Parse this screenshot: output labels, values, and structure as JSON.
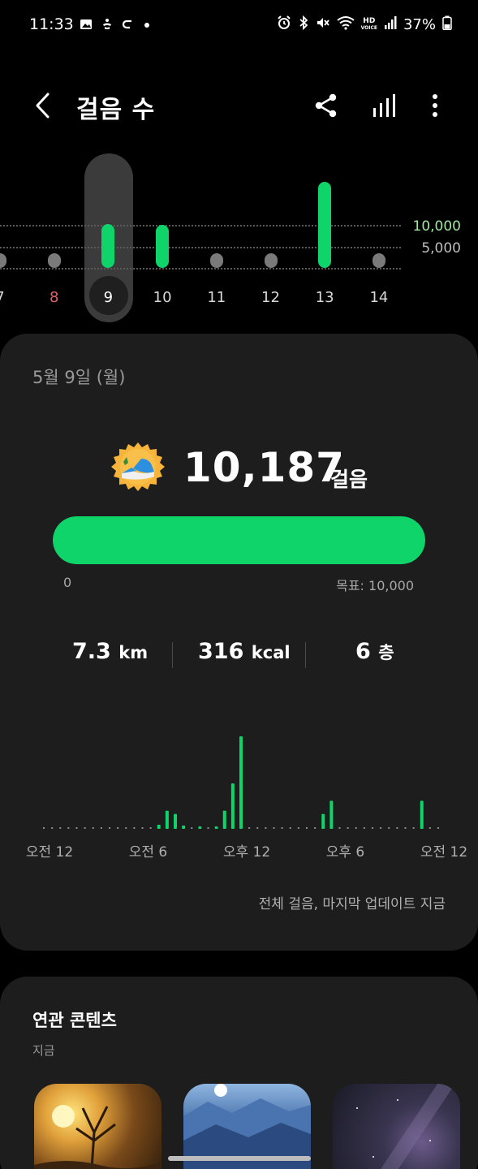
{
  "status_bar": {
    "time": "11:33",
    "battery": "37%",
    "left_icons": [
      "gallery-icon",
      "accessibility-icon",
      "link-icon",
      "dot-icon"
    ],
    "right_icons": [
      "alarm-icon",
      "bluetooth-icon",
      "mute-icon",
      "wifi-icon",
      "hd-voice-icon",
      "signal-icon",
      "battery-icon"
    ],
    "hd_label": "HD",
    "voice_label": "VOICE"
  },
  "header": {
    "title": "걸음 수",
    "icons": [
      "back-icon",
      "share-icon",
      "bar-chart-icon",
      "more-vert-icon"
    ]
  },
  "week_chart": {
    "goal_label": "10,000",
    "mid_label": "5,000",
    "goal": 10000,
    "selected_day": "9",
    "days": [
      {
        "label": "7",
        "steps": 0,
        "color": "#d8d8d8"
      },
      {
        "label": "8",
        "steps": 0,
        "color": "#e0606a"
      },
      {
        "label": "9",
        "steps": 10187,
        "color": "#ffffff"
      },
      {
        "label": "10",
        "steps": 10000,
        "color": "#d8d8d8"
      },
      {
        "label": "11",
        "steps": 0,
        "color": "#d8d8d8"
      },
      {
        "label": "12",
        "steps": 0,
        "color": "#d8d8d8"
      },
      {
        "label": "13",
        "steps": 20000,
        "color": "#d8d8d8"
      },
      {
        "label": "14",
        "steps": 0,
        "color": "#d8d8d8"
      }
    ]
  },
  "summary": {
    "date": "5월 9일 (월)",
    "steps": "10,187",
    "steps_unit": "걸음",
    "progress_fraction": 1.0,
    "progress_min": "0",
    "goal_text": "목표: 10,000",
    "distance_value": "7.3",
    "distance_unit": "km",
    "calories_value": "316",
    "calories_unit": "kcal",
    "floors_value": "6",
    "floors_unit": "층",
    "hour_labels": [
      "오전 12",
      "오전 6",
      "오후 12",
      "오후 6",
      "오전 12"
    ],
    "hourly_steps": [
      0,
      0,
      0,
      0,
      0,
      0,
      0,
      0,
      0,
      0,
      0,
      0,
      0,
      0,
      0,
      0,
      0,
      0,
      0,
      0,
      0,
      0,
      0,
      0,
      0,
      0,
      0,
      0,
      0,
      0,
      0,
      0,
      0,
      0,
      0,
      0,
      0,
      0,
      0,
      0,
      0,
      0,
      0,
      0,
      0,
      0,
      0,
      0,
      0,
      0,
      0,
      0,
      0,
      0,
      0,
      0,
      0,
      0,
      0,
      0,
      0,
      0,
      0,
      5,
      0,
      0,
      0,
      0,
      0,
      0,
      0,
      0,
      0,
      0,
      0,
      0,
      0,
      0,
      0,
      0,
      0,
      0,
      0,
      0,
      0,
      0,
      0,
      0,
      0,
      0,
      0,
      0,
      0,
      0,
      0,
      0,
      0,
      0,
      0,
      0,
      0,
      0,
      0,
      0,
      0,
      0,
      0,
      0,
      0,
      0,
      0,
      0,
      0,
      0,
      0,
      0,
      0,
      0,
      0,
      0,
      0,
      0,
      0,
      0
    ],
    "hourly_bars": [
      {
        "hour": 7.0,
        "value": 5
      },
      {
        "hour": 7.5,
        "value": 22
      },
      {
        "hour": 8.0,
        "value": 18
      },
      {
        "hour": 8.5,
        "value": 4
      },
      {
        "hour": 9.5,
        "value": 3
      },
      {
        "hour": 10.5,
        "value": 3
      },
      {
        "hour": 11.0,
        "value": 22
      },
      {
        "hour": 11.5,
        "value": 55
      },
      {
        "hour": 12.0,
        "value": 112
      },
      {
        "hour": 17.0,
        "value": 18
      },
      {
        "hour": 17.5,
        "value": 34
      },
      {
        "hour": 23.0,
        "value": 34
      }
    ],
    "updated_text": "전체 걸음, 마지막 업데이트 지금"
  },
  "related": {
    "title": "연관 콘텐츠",
    "subtitle": "지금"
  },
  "colors": {
    "accent": "#0fd46a",
    "card": "#1d1d1d",
    "background": "#000000"
  }
}
